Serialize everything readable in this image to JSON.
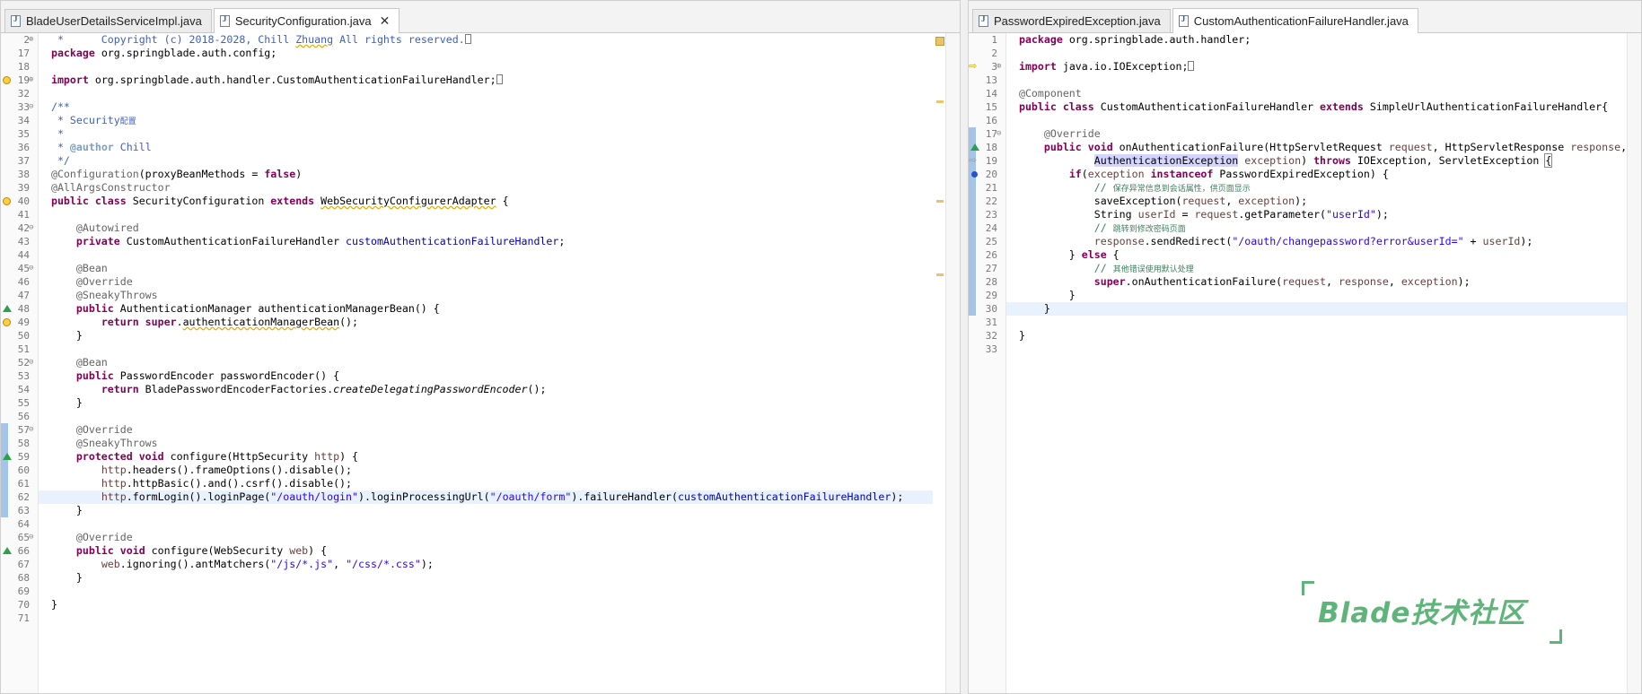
{
  "left_pane": {
    "tabs": [
      {
        "label": "BladeUserDetailsServiceImpl.java",
        "active": false
      },
      {
        "label": "SecurityConfiguration.java",
        "active": true,
        "closable": true
      }
    ],
    "current_line": 62
  },
  "right_pane": {
    "tabs": [
      {
        "label": "PasswordExpiredException.java",
        "active": false
      },
      {
        "label": "CustomAuthenticationFailureHandler.java",
        "active": true
      }
    ],
    "current_line": 30
  },
  "watermark": {
    "text": "Blade技术社区",
    "color": "#5fb47a"
  },
  "colors": {
    "keyword": "#7f0055",
    "string": "#2a00ff",
    "comment": "#3f7f5f",
    "javadoc": "#3f5fbf",
    "annotation": "#646464",
    "field": "#0000c0",
    "current_line": "#e8f2fe"
  }
}
